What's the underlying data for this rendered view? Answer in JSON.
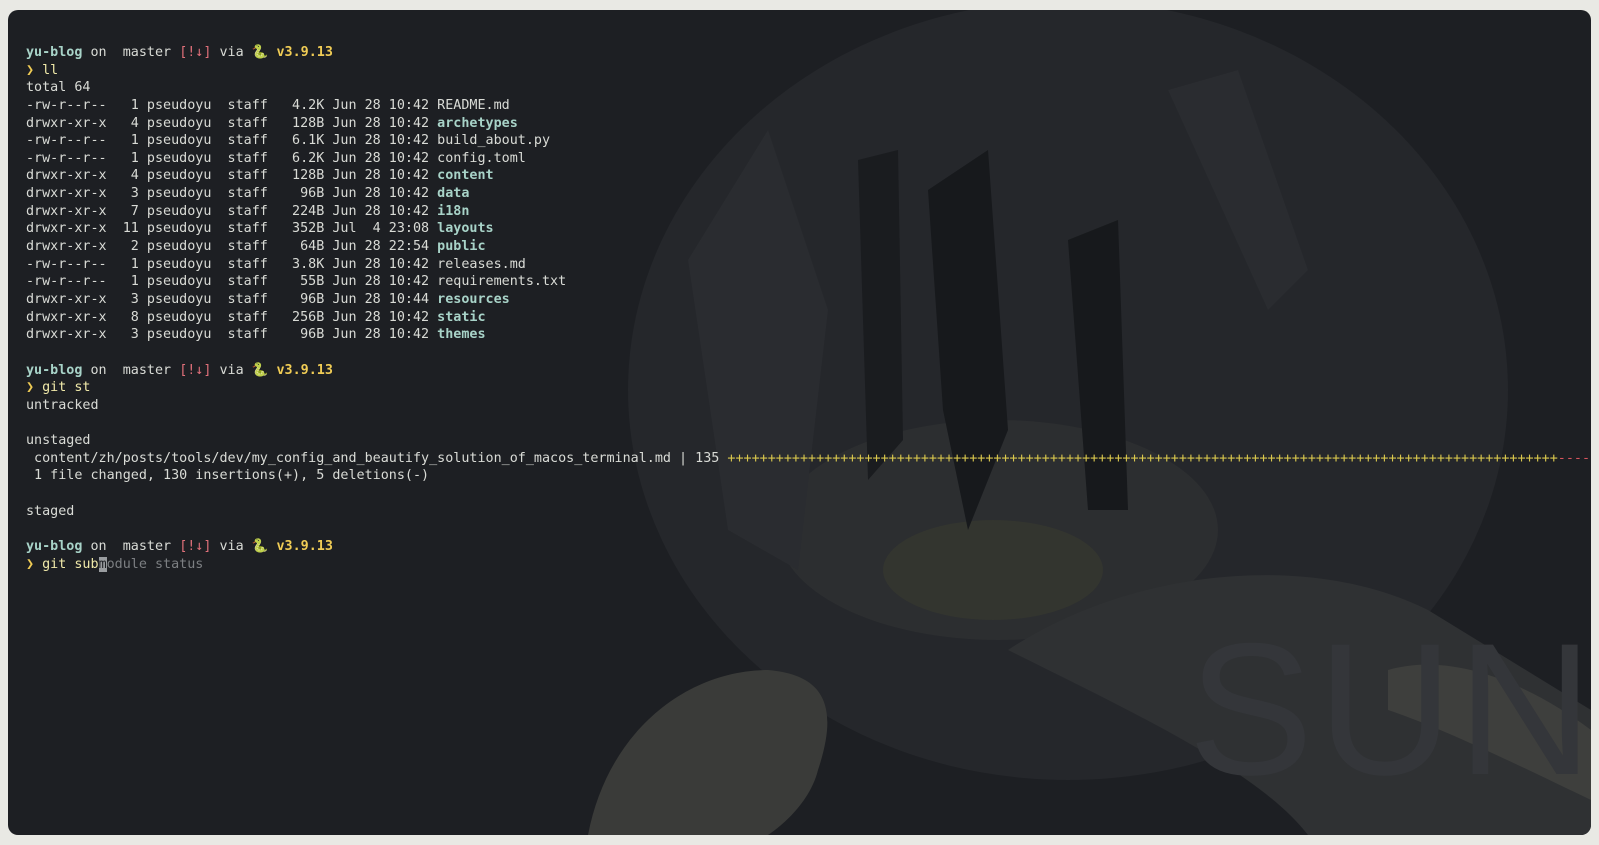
{
  "watermark": "SUN",
  "prompt": {
    "dir": "yu-blog",
    "on": "on",
    "branch_icon": "",
    "branch": "master",
    "git_status": "[!↓]",
    "via": "via",
    "python_icon": "🐍",
    "version": "v3.9.13",
    "symbol": "❯"
  },
  "blocks": [
    {
      "command": "ll",
      "output": {
        "total": "total 64",
        "entries": [
          {
            "perm": "-rw-r--r--",
            "links": "1",
            "owner": "pseudoyu",
            "group": "staff",
            "size": "4.2K",
            "date": "Jun 28 10:42",
            "name": "README.md",
            "is_dir": false
          },
          {
            "perm": "drwxr-xr-x",
            "links": "4",
            "owner": "pseudoyu",
            "group": "staff",
            "size": "128B",
            "date": "Jun 28 10:42",
            "name": "archetypes",
            "is_dir": true
          },
          {
            "perm": "-rw-r--r--",
            "links": "1",
            "owner": "pseudoyu",
            "group": "staff",
            "size": "6.1K",
            "date": "Jun 28 10:42",
            "name": "build_about.py",
            "is_dir": false
          },
          {
            "perm": "-rw-r--r--",
            "links": "1",
            "owner": "pseudoyu",
            "group": "staff",
            "size": "6.2K",
            "date": "Jun 28 10:42",
            "name": "config.toml",
            "is_dir": false
          },
          {
            "perm": "drwxr-xr-x",
            "links": "4",
            "owner": "pseudoyu",
            "group": "staff",
            "size": "128B",
            "date": "Jun 28 10:42",
            "name": "content",
            "is_dir": true
          },
          {
            "perm": "drwxr-xr-x",
            "links": "3",
            "owner": "pseudoyu",
            "group": "staff",
            "size": "96B",
            "date": "Jun 28 10:42",
            "name": "data",
            "is_dir": true
          },
          {
            "perm": "drwxr-xr-x",
            "links": "7",
            "owner": "pseudoyu",
            "group": "staff",
            "size": "224B",
            "date": "Jun 28 10:42",
            "name": "i18n",
            "is_dir": true
          },
          {
            "perm": "drwxr-xr-x",
            "links": "11",
            "owner": "pseudoyu",
            "group": "staff",
            "size": "352B",
            "date": "Jul  4 23:08",
            "name": "layouts",
            "is_dir": true
          },
          {
            "perm": "drwxr-xr-x",
            "links": "2",
            "owner": "pseudoyu",
            "group": "staff",
            "size": "64B",
            "date": "Jun 28 22:54",
            "name": "public",
            "is_dir": true
          },
          {
            "perm": "-rw-r--r--",
            "links": "1",
            "owner": "pseudoyu",
            "group": "staff",
            "size": "3.8K",
            "date": "Jun 28 10:42",
            "name": "releases.md",
            "is_dir": false
          },
          {
            "perm": "-rw-r--r--",
            "links": "1",
            "owner": "pseudoyu",
            "group": "staff",
            "size": "55B",
            "date": "Jun 28 10:42",
            "name": "requirements.txt",
            "is_dir": false
          },
          {
            "perm": "drwxr-xr-x",
            "links": "3",
            "owner": "pseudoyu",
            "group": "staff",
            "size": "96B",
            "date": "Jun 28 10:44",
            "name": "resources",
            "is_dir": true
          },
          {
            "perm": "drwxr-xr-x",
            "links": "8",
            "owner": "pseudoyu",
            "group": "staff",
            "size": "256B",
            "date": "Jun 28 10:42",
            "name": "static",
            "is_dir": true
          },
          {
            "perm": "drwxr-xr-x",
            "links": "3",
            "owner": "pseudoyu",
            "group": "staff",
            "size": "96B",
            "date": "Jun 28 10:42",
            "name": "themes",
            "is_dir": true
          }
        ]
      }
    },
    {
      "command": "git st",
      "output": {
        "untracked": "untracked",
        "unstaged": "unstaged",
        "diff_path": " content/zh/posts/tools/dev/my_config_and_beautify_solution_of_macos_terminal.md | 135 ",
        "diff_plus": "+++++++++++++++++++++++++++++++++++++++++++++++++++++++++++++++++++++++++++++++++++++++++++++++++++++++",
        "diff_minus": "-----",
        "summary": " 1 file changed, 130 insertions(+), 5 deletions(-)",
        "staged": "staged"
      }
    }
  ],
  "current_input": {
    "typed_before_cursor": "git sub",
    "cursor_char": "m",
    "suggestion": "odule status"
  },
  "colors": {
    "background": "#1d1f23",
    "foreground": "#d9dbd6",
    "directory": "#a8d3c8",
    "accent_yellow": "#f0cc55",
    "status_red": "#e0707a",
    "diff_plus": "#d9c74d",
    "diff_minus": "#d7555d"
  }
}
